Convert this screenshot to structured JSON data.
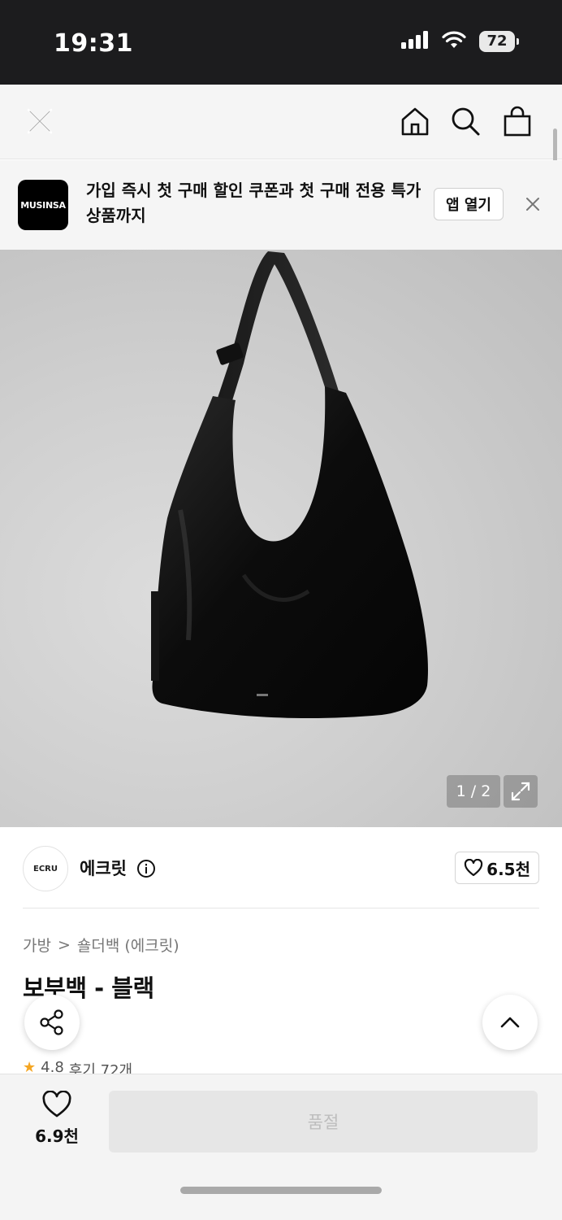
{
  "status_bar": {
    "time": "19:31",
    "battery": "72"
  },
  "nav": {
    "close": "close-icon",
    "home": "home-icon",
    "search": "search-icon",
    "cart": "shopping-bag-icon"
  },
  "banner": {
    "logo_text": "MUSINSA",
    "message": "가입 즉시 첫 구매 할인 쿠폰과 첫 구매 전용 특가 상품까지",
    "open_app_label": "앱 열기"
  },
  "gallery": {
    "counter": "1 / 2"
  },
  "brand": {
    "logo_text": "ECRU",
    "name": "에크릿",
    "like_count": "6.5천"
  },
  "breadcrumb": {
    "category": "가방",
    "separator": ">",
    "subcategory": "숄더백 (에크릿)"
  },
  "product": {
    "title": "보부백 - 블랙",
    "rating": "4.8",
    "reviews": "후기 72개"
  },
  "bottom_bar": {
    "wish_count": "6.9천",
    "soldout_label": "품절"
  },
  "colors": {
    "status_bar_bg": "#1c1c1e",
    "banner_bg": "#f5f5f5",
    "rating_star": "#f5a623",
    "soldout_bg": "#e6e6e6"
  }
}
